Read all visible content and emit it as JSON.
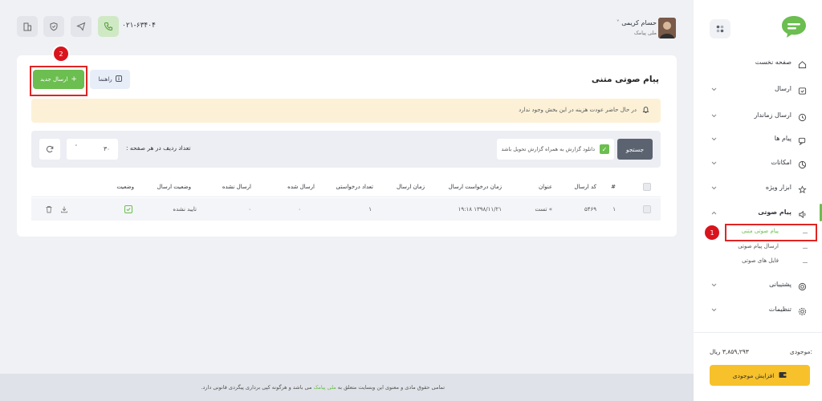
{
  "header": {
    "phone": "۰۲۱-۶۳۴۰۴",
    "user_name": "حسام کریمی",
    "user_sub": "ملی پیامک"
  },
  "sidebar": {
    "items": [
      {
        "label": "صفحه نخست",
        "icon": "home-icon",
        "chevron": false
      },
      {
        "label": "ارسال",
        "icon": "send-box-icon",
        "chevron": true
      },
      {
        "label": "ارسال زماندار",
        "icon": "clock-icon",
        "chevron": true
      },
      {
        "label": "پیام ها",
        "icon": "messages-icon",
        "chevron": true
      },
      {
        "label": "امکانات",
        "icon": "features-icon",
        "chevron": true
      },
      {
        "label": "ابزار ویژه",
        "icon": "star-icon",
        "chevron": true
      },
      {
        "label": "پیام صوتی",
        "icon": "speaker-icon",
        "chevron": true,
        "expanded": true
      },
      {
        "label": "پشتیبانی",
        "icon": "support-icon",
        "chevron": true
      },
      {
        "label": "تنظیمات",
        "icon": "settings-icon",
        "chevron": true
      }
    ],
    "sub_items": [
      {
        "label": "پیام صوتی متنی",
        "active": true
      },
      {
        "label": "ارسال پیام صوتی",
        "active": false
      },
      {
        "label": "فایل های صوتی",
        "active": false
      }
    ],
    "balance_label": "موجودی:",
    "balance_value": "۳,۸۵۹,۲۹۳ ریال",
    "balance_button": "افزایش موجودی"
  },
  "main": {
    "page_title": "پیام صوتی متنی",
    "new_button": "ارسال جدید",
    "guide_button": "راهنما",
    "notice": "در حال حاضر عودت هزینه در این بخش وجود ندارد",
    "search_button": "جستجو",
    "download_checkbox_label": "دانلود گزارش به همراه گزارش تحویل باشد",
    "rows_per_page_label": "تعداد ردیف در هر صفحه :",
    "rows_per_page_value": "۳۰",
    "table": {
      "headers": [
        "#",
        "کد ارسال",
        "عنوان",
        "زمان درخواست ارسال",
        "زمان ارسال",
        "تعداد درخواستی",
        "ارسال شده",
        "ارسال نشده",
        "وضعیت ارسال",
        "وضعیت"
      ],
      "rows": [
        {
          "index": "۱",
          "code": "۵۴۶۹",
          "title": "» تست",
          "request_time": "۱۳۹۸/۱۱/۲۱ ۱۹:۱۸",
          "send_time": "",
          "requested": "۱",
          "sent": "۰",
          "not_sent": "۰",
          "send_status": "تایید نشده"
        }
      ]
    }
  },
  "annotations": {
    "badge_1": "1",
    "badge_2": "2"
  },
  "footer": {
    "text_before": "تمامی حقوق مادی و معنوی این وبسایت متعلق به",
    "link": "ملی پیامک",
    "text_after": "می باشد و هرگونه کپی برداری پیگردی قانونی دارد."
  },
  "colors": {
    "accent": "#6bbe4f",
    "warning": "#f7c12c",
    "notice_bg": "#fcf1d7",
    "annotation_red": "#e02424"
  }
}
